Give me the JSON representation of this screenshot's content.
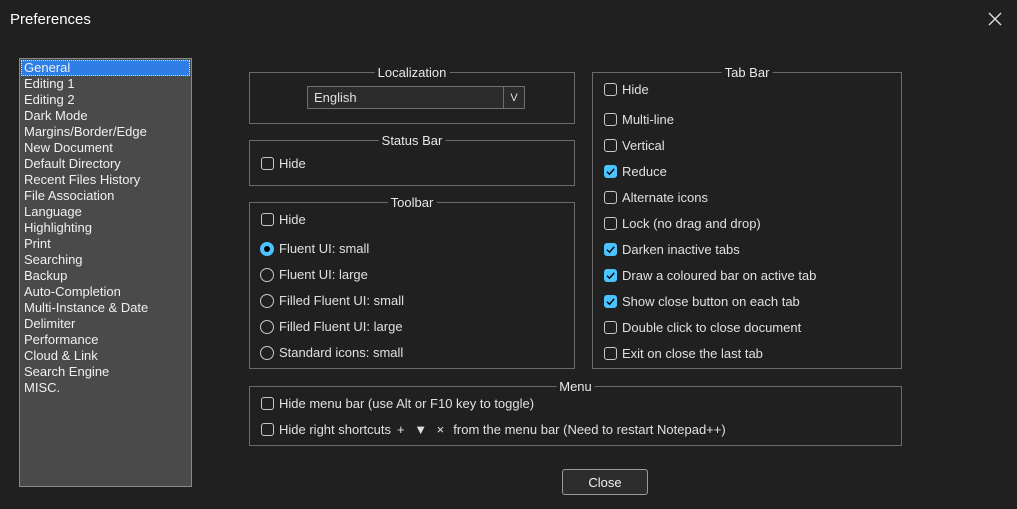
{
  "window": {
    "title": "Preferences"
  },
  "categories": [
    "General",
    "Editing 1",
    "Editing 2",
    "Dark Mode",
    "Margins/Border/Edge",
    "New Document",
    "Default Directory",
    "Recent Files History",
    "File Association",
    "Language",
    "Highlighting",
    "Print",
    "Searching",
    "Backup",
    "Auto-Completion",
    "Multi-Instance & Date",
    "Delimiter",
    "Performance",
    "Cloud & Link",
    "Search Engine",
    "MISC."
  ],
  "selected_category": "General",
  "localization": {
    "legend": "Localization",
    "selected": "English",
    "arrow": "V"
  },
  "status_bar": {
    "legend": "Status Bar",
    "hide_label": "Hide",
    "hide_checked": false
  },
  "toolbar": {
    "legend": "Toolbar",
    "hide_label": "Hide",
    "hide_checked": false,
    "options": [
      {
        "label": "Fluent UI: small",
        "selected": true
      },
      {
        "label": "Fluent UI: large",
        "selected": false
      },
      {
        "label": "Filled Fluent UI: small",
        "selected": false
      },
      {
        "label": "Filled Fluent UI: large",
        "selected": false
      },
      {
        "label": "Standard icons: small",
        "selected": false
      }
    ]
  },
  "tab_bar": {
    "legend": "Tab Bar",
    "options": [
      {
        "label": "Hide",
        "checked": false
      },
      {
        "label": "Multi-line",
        "checked": false
      },
      {
        "label": "Vertical",
        "checked": false
      },
      {
        "label": "Reduce",
        "checked": true
      },
      {
        "label": "Alternate icons",
        "checked": false
      },
      {
        "label": "Lock (no drag and drop)",
        "checked": false
      },
      {
        "label": "Darken inactive tabs",
        "checked": true
      },
      {
        "label": "Draw a coloured bar on active tab",
        "checked": true
      },
      {
        "label": "Show close button on each tab",
        "checked": true
      },
      {
        "label": "Double click to close document",
        "checked": false
      },
      {
        "label": "Exit on close the last tab",
        "checked": false
      }
    ]
  },
  "menu": {
    "legend": "Menu",
    "hide_menu_bar": "Hide menu bar (use Alt or F10 key to toggle)",
    "hide_shortcuts_pre": "Hide right shortcuts",
    "hide_shortcuts_symbols": "+ ▼ ×",
    "hide_shortcuts_post": "from the menu bar (Need to restart Notepad++)"
  },
  "buttons": {
    "close": "Close"
  },
  "colors": {
    "accent": "#4cc2ff",
    "selection": "#2e7ee6",
    "background": "#202020"
  }
}
